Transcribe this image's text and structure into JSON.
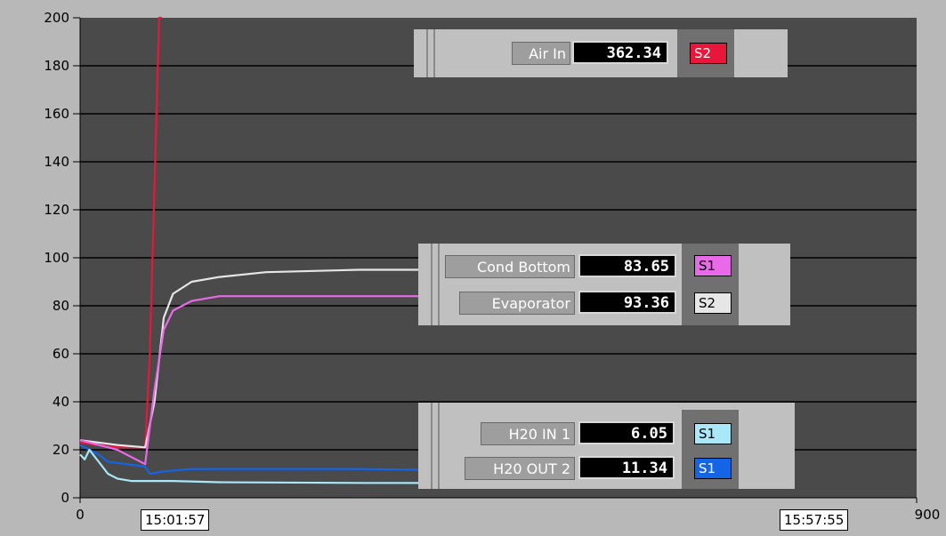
{
  "chart_data": {
    "type": "line",
    "xlim": [
      0,
      900
    ],
    "ylim": [
      0,
      200
    ],
    "yticks": [
      0,
      20,
      40,
      60,
      80,
      100,
      120,
      140,
      160,
      180,
      200
    ],
    "xtick_labels": [
      "0",
      "900"
    ],
    "grid": true,
    "plot_bg": "#4a4a4a",
    "time_start": "15:01:57",
    "time_end": "15:57:55",
    "series": [
      {
        "name": "Air In",
        "color": "#e8163a",
        "x": [
          0,
          20,
          40,
          60,
          70,
          75,
          80,
          85,
          88
        ],
        "y": [
          23,
          22,
          21,
          21,
          21,
          60,
          130,
          200,
          200
        ]
      },
      {
        "name": "Evaporator",
        "color": "#e6e6e6",
        "x": [
          0,
          40,
          70,
          80,
          90,
          100,
          120,
          150,
          200,
          300,
          400,
          500,
          600,
          680
        ],
        "y": [
          24,
          22,
          21,
          40,
          75,
          85,
          90,
          92,
          94,
          95,
          95,
          94,
          93,
          93.36
        ]
      },
      {
        "name": "Cond Bottom",
        "color": "#e86ae8",
        "x": [
          0,
          40,
          70,
          80,
          90,
          100,
          120,
          150,
          200,
          300,
          400,
          500,
          600,
          680
        ],
        "y": [
          24,
          20,
          14,
          45,
          70,
          78,
          82,
          84,
          84,
          84,
          84,
          84,
          83.6,
          83.65
        ]
      },
      {
        "name": "H20 OUT 2",
        "color": "#1464e6",
        "x": [
          0,
          10,
          20,
          30,
          50,
          70,
          75,
          90,
          120,
          200,
          300,
          400,
          500,
          600,
          680
        ],
        "y": [
          22,
          20,
          18,
          15,
          14,
          13,
          10,
          11,
          12,
          12,
          12,
          11.5,
          11.5,
          11.3,
          11.34
        ]
      },
      {
        "name": "H20 IN 1",
        "color": "#a8e8f8",
        "x": [
          0,
          5,
          10,
          20,
          30,
          40,
          55,
          70,
          100,
          150,
          300,
          500,
          680
        ],
        "y": [
          18,
          16,
          20,
          15,
          10,
          8,
          7,
          7,
          7,
          6.5,
          6.2,
          6.1,
          6.05
        ]
      }
    ]
  },
  "readouts": {
    "air_in": {
      "label": "Air In",
      "value": "362.34",
      "tag": "S2",
      "tag_color": "#e8163a",
      "tag_text_color": "#ffffff"
    },
    "cond_bottom": {
      "label": "Cond Bottom",
      "value": "83.65",
      "tag": "S1",
      "tag_color": "#e86ae8",
      "tag_text_color": "#000000"
    },
    "evaporator": {
      "label": "Evaporator",
      "value": "93.36",
      "tag": "S2",
      "tag_color": "#e6e6e6",
      "tag_text_color": "#000000"
    },
    "h2o_in_1": {
      "label": "H20 IN 1",
      "value": "6.05",
      "tag": "S1",
      "tag_color": "#a8e8f8",
      "tag_text_color": "#000000"
    },
    "h2o_out_2": {
      "label": "H20 OUT 2",
      "value": "11.34",
      "tag": "S1",
      "tag_color": "#1464e6",
      "tag_text_color": "#ffffff"
    }
  }
}
